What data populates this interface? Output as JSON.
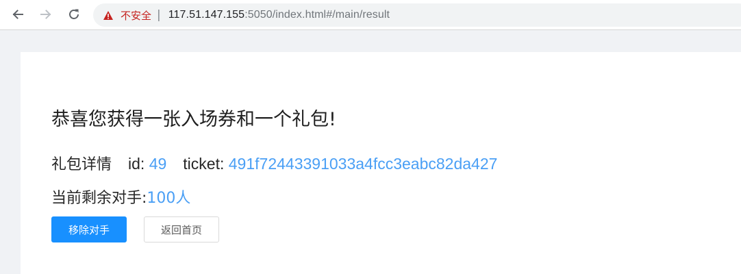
{
  "browser": {
    "security_label": "不安全",
    "separator": "|",
    "url_host": "117.51.147.155",
    "url_rest": ":5050/index.html#/main/result"
  },
  "page": {
    "headline": "恭喜您获得一张入场券和一个礼包!",
    "gift_label": "礼包详情",
    "id_key": "id: ",
    "id_value": "49",
    "ticket_key": "ticket: ",
    "ticket_value": "491f72443391033a4fcc3eabc82da427",
    "remain_label": "当前剩余对手:",
    "remain_value": "100人",
    "remove_button": "移除对手",
    "home_button": "返回首页"
  },
  "colors": {
    "primary": "#1890ff",
    "link": "#4a9ff5",
    "warning": "#c5221f"
  },
  "icons": [
    "back-arrow-icon",
    "forward-arrow-icon",
    "reload-icon",
    "warning-triangle-icon"
  ]
}
